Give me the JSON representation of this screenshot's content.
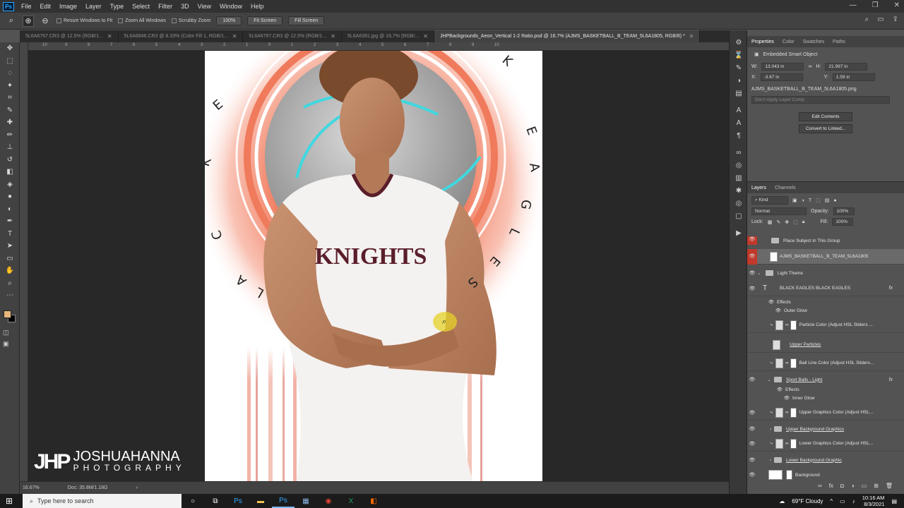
{
  "menu": {
    "app_logo": "Ps",
    "items": [
      "File",
      "Edit",
      "Image",
      "Layer",
      "Type",
      "Select",
      "Filter",
      "3D",
      "View",
      "Window",
      "Help"
    ]
  },
  "options_bar": {
    "resize_windows": "Resize Windows to Fit",
    "zoom_all": "Zoom All Windows",
    "scrubby_zoom": "Scrubby Zoom",
    "zoom_percent": "100%",
    "fit_screen": "Fit Screen",
    "fill_screen": "Fill Screen"
  },
  "tabs": [
    {
      "label": "5L6A6767.CR3 @ 12.5% (RGB/1...",
      "active": false
    },
    {
      "label": "5L6A6846.CR3 @ 8.33% (Color Fill 1, RGB/1...",
      "active": false
    },
    {
      "label": "5L6A6797.CR3 @ 12.5% (RGB/1...",
      "active": false
    },
    {
      "label": "5L6A6391.jpg @ 16.7% (RGB/...",
      "active": false
    },
    {
      "label": "JHPBackgrounds_Aeon_Vertical 1-2 Ratio.psd @ 16.7% (AJMS_BASKETBALL_B_TEAM_5L6A1805, RGB/8) *",
      "active": true
    }
  ],
  "ruler_ticks": [
    "10",
    "9",
    "8",
    "7",
    "6",
    "5",
    "4",
    "3",
    "2",
    "1",
    "0",
    "1",
    "2",
    "3",
    "4",
    "5",
    "6",
    "7",
    "8",
    "9",
    "10"
  ],
  "canvas": {
    "arc_text": "BLACK EAGLES BLACK EAGLES",
    "jersey_text": "KNIGHTS",
    "accent_color": "#f07a5c",
    "glow_color": "#3fd8e0"
  },
  "watermark": {
    "name": "JOSHUAHANNA",
    "sub": "PHOTOGRAPHY"
  },
  "status": {
    "zoom": "16.67%",
    "doc": "Doc: 35.8M/1.18G"
  },
  "properties": {
    "tabs": [
      "Properties",
      "Color",
      "Swatches",
      "Paths"
    ],
    "type_label": "Embedded Smart Object",
    "w_label": "W:",
    "w_value": "13.043 in",
    "h_label": "H:",
    "h_value": "21.997 in",
    "x_label": "X:",
    "x_value": "-3.67 in",
    "y_label": "Y:",
    "y_value": "1.59 in",
    "filename": "AJMS_BASKETBALL_B_TEAM_5L6A1805.png",
    "layer_comp": "Don't Apply Layer Comp",
    "edit_contents": "Edit Contents",
    "convert_linked": "Convert to Linked..."
  },
  "layers_panel": {
    "tabs": [
      "Layers",
      "Channels"
    ],
    "kind": "Kind",
    "blend_mode": "Normal",
    "opacity_label": "Opacity:",
    "opacity": "100%",
    "lock_label": "Lock:",
    "fill_label": "Fill:",
    "fill": "100%",
    "layers": [
      {
        "name": "Place Subject in This Group"
      },
      {
        "name": "AJMS_BASKETBALL_B_TEAM_5L6A1805"
      },
      {
        "name": "Light Theme"
      },
      {
        "name": "BLACK EAGLES BLACK EAGLES"
      },
      {
        "name": "Effects"
      },
      {
        "name": "Outer Glow"
      },
      {
        "name": "Particle Color (Adjust HSL Sliders ..."
      },
      {
        "name": "Upper Particles"
      },
      {
        "name": "Ball Line Color (Adjust HSL Sliders..."
      },
      {
        "name": "Sport Balls - Light"
      },
      {
        "name": "Effects"
      },
      {
        "name": "Inner Glow"
      },
      {
        "name": "Upper Graphics Color (Adjust HSL..."
      },
      {
        "name": "Upper Background Graphics"
      },
      {
        "name": "Lower Graphics Color (Adjust HSL..."
      },
      {
        "name": "Lower Background Graphic"
      },
      {
        "name": "Background"
      }
    ],
    "fx": "fx"
  },
  "taskbar": {
    "search_placeholder": "Type here to search",
    "weather": "69°F  Cloudy",
    "time": "10:16 AM",
    "date": "8/3/2021"
  }
}
